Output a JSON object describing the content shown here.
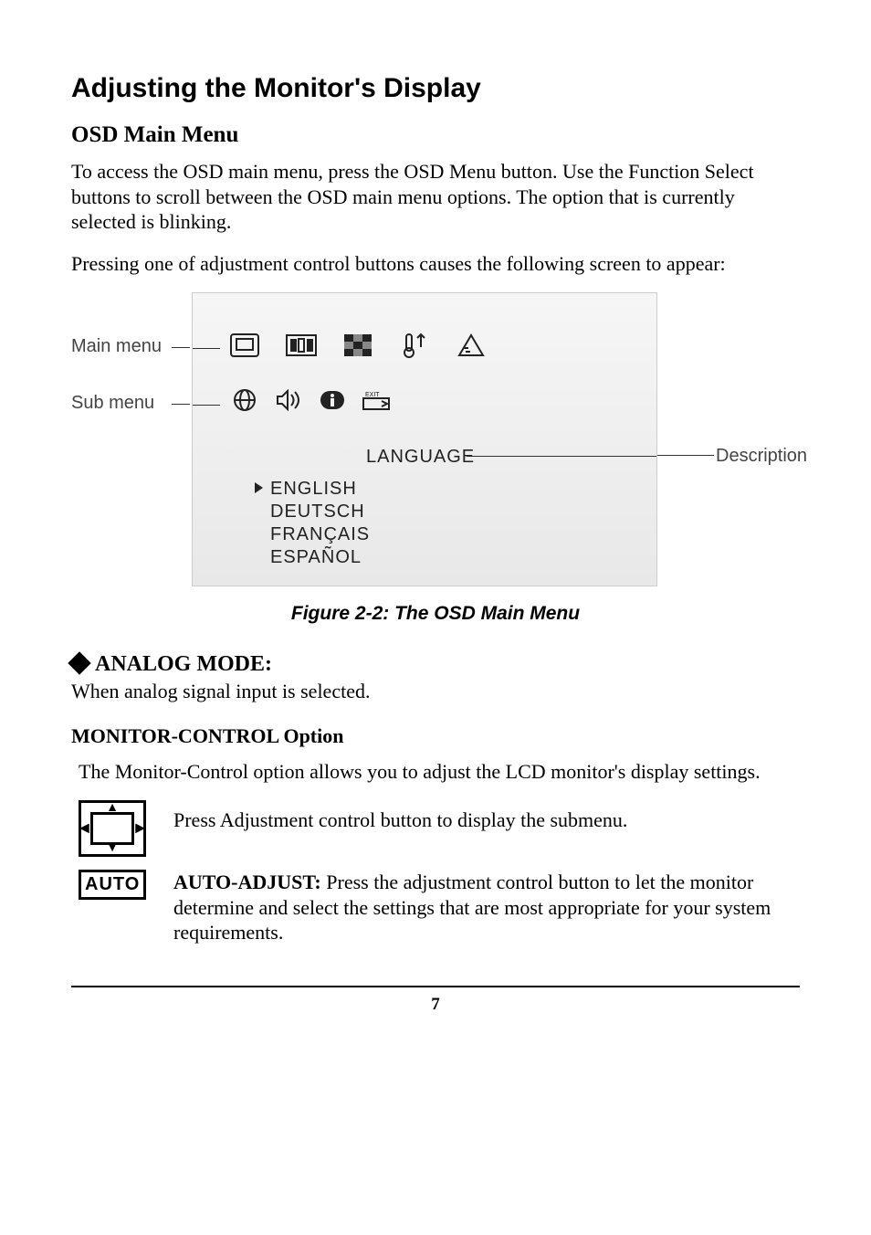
{
  "title": "Adjusting the Monitor's Display",
  "sections": {
    "osd_menu": {
      "heading": "OSD Main Menu",
      "para1": "To access the OSD main menu, press the OSD Menu button. Use the Function Select buttons to scroll between the OSD main menu options. The option that is currently selected is blinking.",
      "para2": "Pressing one of adjustment control buttons causes the following screen to appear:"
    },
    "figure": {
      "left_label_main": "Main menu",
      "left_label_sub": "Sub menu",
      "right_label_desc": "Description",
      "language_label": "LANGUAGE",
      "languages": [
        "ENGLISH",
        "DEUTSCH",
        "FRANÇAIS",
        "ESPAÑOL"
      ],
      "caption": "Figure 2-2: The OSD Main Menu"
    },
    "analog": {
      "heading": "ANALOG MODE:",
      "sub": "When analog signal input is selected."
    },
    "monitor_control": {
      "heading": "MONITOR-CONTROL Option",
      "intro": "The Monitor-Control option allows you to adjust the LCD monitor's display settings.",
      "press_text": "Press Adjustment control button to display the submenu.",
      "auto_label": "AUTO",
      "auto_bold": "AUTO-ADJUST:",
      "auto_text": " Press the adjustment control button to let the monitor determine and select the settings that are most appropriate for your system requirements."
    }
  },
  "page_number": "7"
}
